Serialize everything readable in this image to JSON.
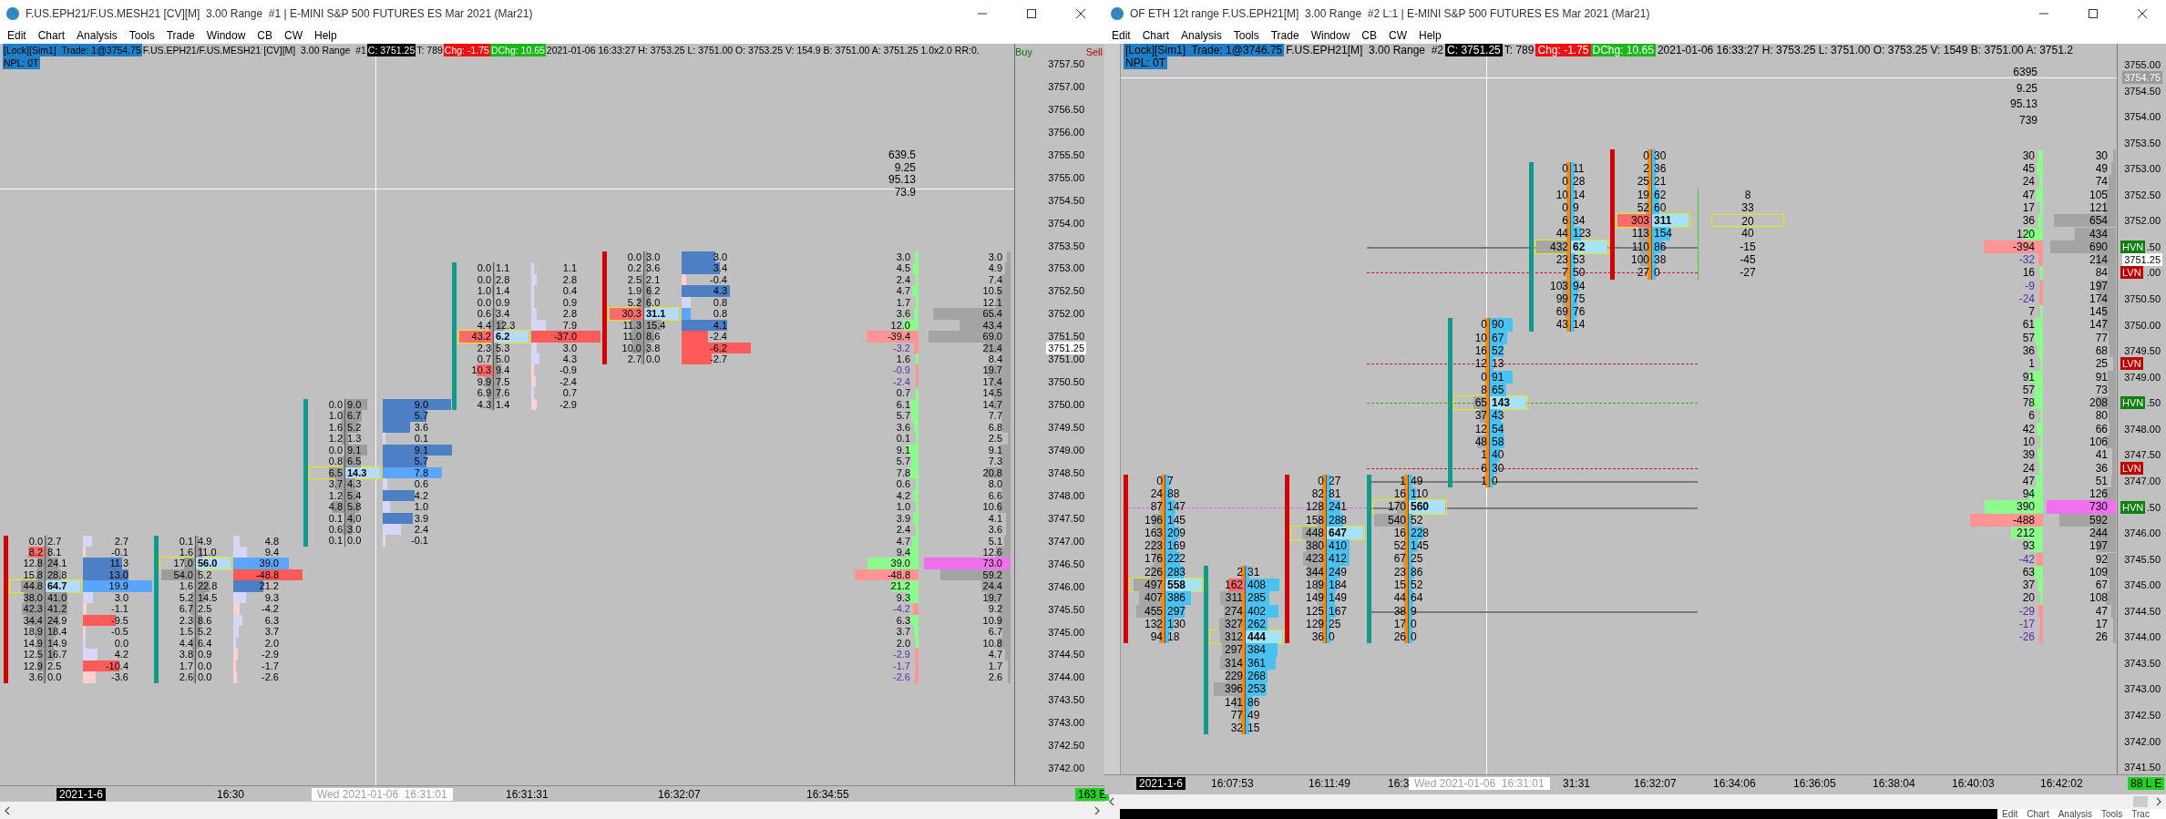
{
  "windows": [
    {
      "title": "F.US.EPH21/F.US.MESH21 [CV][M]  3.00 Range  #1 | E-MINI S&P 500 FUTURES ES Mar 2021 (Mar21)",
      "menu": [
        "Edit",
        "Chart",
        "Analysis",
        "Tools",
        "Trade",
        "Window",
        "CB",
        "CW",
        "Help"
      ],
      "info": {
        "account": "[Lock][Sim1]  Trade: 1@3754.75",
        "instrument": "F.US.EPH21/F.US.MESH21 [CV][M]  3.00 Range  #1",
        "close": "C: 3751.25",
        "ticks": "T: 789",
        "change": "Chg: -1.75",
        "day_change": "DChg: 10.65",
        "details": "2021-01-06 16:33:27 H: 3753.25 L: 3751.00 O: 3753.25 V: 154.9 B: 3751.00 A: 3751.25 1.0x2.0 RR:0.",
        "npl": "NPL: 0T"
      },
      "order_buttons": [
        {
          "label": "Buy",
          "kind": "buy"
        },
        {
          "label": "Sell",
          "kind": "sell"
        }
      ],
      "stats": [
        "639.5",
        "9.25",
        "95.13",
        "73.9"
      ],
      "columns": [
        {
          "kind": "down",
          "rows": [
            {
              "bid": "0.0",
              "ask": "2.7",
              "delta": "2.7",
              "poc": false,
              "alert": false
            },
            {
              "bid": "8.2",
              "ask": "8.1",
              "delta": "-0.1",
              "poc": false,
              "alert": true
            },
            {
              "bid": "12.8",
              "ask": "24.1",
              "delta": "11.3",
              "poc": false,
              "alert": false
            },
            {
              "bid": "15.8",
              "ask": "28.8",
              "delta": "13.0",
              "poc": false,
              "alert": false
            },
            {
              "bid": "44.8",
              "ask": "64.7",
              "delta": "19.9",
              "poc": true,
              "alert": false
            },
            {
              "bid": "38.0",
              "ask": "41.0",
              "delta": "3.0",
              "poc": false,
              "alert": false
            },
            {
              "bid": "42.3",
              "ask": "41.2",
              "delta": "-1.1",
              "poc": false,
              "alert": false
            },
            {
              "bid": "34.4",
              "ask": "24.9",
              "delta": "-9.5",
              "poc": false,
              "alert": false
            },
            {
              "bid": "18.9",
              "ask": "18.4",
              "delta": "-0.5",
              "poc": false,
              "alert": false
            },
            {
              "bid": "14.9",
              "ask": "14.9",
              "delta": "0.0",
              "poc": false,
              "alert": false
            },
            {
              "bid": "12.5",
              "ask": "16.7",
              "delta": "4.2",
              "poc": false,
              "alert": false
            },
            {
              "bid": "12.9",
              "ask": "2.5",
              "delta": "-10.4",
              "poc": false,
              "alert": false
            },
            {
              "bid": "3.6",
              "ask": "0.0",
              "delta": "-3.6",
              "poc": false,
              "alert": false
            }
          ]
        },
        {
          "kind": "up",
          "rows": [
            {
              "bid": "0.1",
              "ask": "4.9",
              "delta": "4.8",
              "poc": false,
              "alert": false
            },
            {
              "bid": "1.6",
              "ask": "11.0",
              "delta": "9.4",
              "poc": false,
              "alert": false
            },
            {
              "bid": "17.0",
              "ask": "56.0",
              "delta": "39.0",
              "poc": true,
              "alert": false
            },
            {
              "bid": "54.0",
              "ask": "5.2",
              "delta": "-48.8",
              "poc": false,
              "alert": false
            },
            {
              "bid": "1.6",
              "ask": "22.8",
              "delta": "21.2",
              "poc": false,
              "alert": false
            },
            {
              "bid": "5.2",
              "ask": "14.5",
              "delta": "9.3",
              "poc": false,
              "alert": false
            },
            {
              "bid": "6.7",
              "ask": "2.5",
              "delta": "-4.2",
              "poc": false,
              "alert": false
            },
            {
              "bid": "2.3",
              "ask": "8.6",
              "delta": "6.3",
              "poc": false,
              "alert": false
            },
            {
              "bid": "1.5",
              "ask": "5.2",
              "delta": "3.7",
              "poc": false,
              "alert": false
            },
            {
              "bid": "4.4",
              "ask": "6.4",
              "delta": "2.0",
              "poc": false,
              "alert": false
            },
            {
              "bid": "3.8",
              "ask": "0.9",
              "delta": "-2.9",
              "poc": false,
              "alert": false
            },
            {
              "bid": "1.7",
              "ask": "0.0",
              "delta": "-1.7",
              "poc": false,
              "alert": false
            },
            {
              "bid": "2.6",
              "ask": "0.0",
              "delta": "-2.6",
              "poc": false,
              "alert": false
            }
          ]
        },
        {
          "kind": "up",
          "rows": [
            {
              "bid": "0.0",
              "ask": "9.0",
              "delta": "9.0",
              "poc": false,
              "alert": false
            },
            {
              "bid": "1.0",
              "ask": "6.7",
              "delta": "5.7",
              "poc": false,
              "alert": false
            },
            {
              "bid": "1.6",
              "ask": "5.2",
              "delta": "3.6",
              "poc": false,
              "alert": false
            },
            {
              "bid": "1.2",
              "ask": "1.3",
              "delta": "0.1",
              "poc": false,
              "alert": false
            },
            {
              "bid": "0.0",
              "ask": "9.1",
              "delta": "9.1",
              "poc": false,
              "alert": false
            },
            {
              "bid": "0.8",
              "ask": "6.5",
              "delta": "5.7",
              "poc": false,
              "alert": false
            },
            {
              "bid": "6.5",
              "ask": "14.3",
              "delta": "7.8",
              "poc": true,
              "alert": false
            },
            {
              "bid": "3.7",
              "ask": "4.3",
              "delta": "0.6",
              "poc": false,
              "alert": false
            },
            {
              "bid": "1.2",
              "ask": "5.4",
              "delta": "4.2",
              "poc": false,
              "alert": false
            },
            {
              "bid": "4.8",
              "ask": "5.8",
              "delta": "1.0",
              "poc": false,
              "alert": false
            },
            {
              "bid": "0.1",
              "ask": "4.0",
              "delta": "3.9",
              "poc": false,
              "alert": false
            },
            {
              "bid": "0.6",
              "ask": "3.0",
              "delta": "2.4",
              "poc": false,
              "alert": false
            },
            {
              "bid": "0.1",
              "ask": "0.0",
              "delta": "-0.1",
              "poc": false,
              "alert": false
            }
          ]
        },
        {
          "kind": "up",
          "rows": [
            {
              "bid": "0.0",
              "ask": "1.1",
              "delta": "1.1",
              "poc": false,
              "alert": false
            },
            {
              "bid": "0.0",
              "ask": "2.8",
              "delta": "2.8",
              "poc": false,
              "alert": false
            },
            {
              "bid": "1.0",
              "ask": "1.4",
              "delta": "0.4",
              "poc": false,
              "alert": false
            },
            {
              "bid": "0.0",
              "ask": "0.9",
              "delta": "0.9",
              "poc": false,
              "alert": false
            },
            {
              "bid": "0.6",
              "ask": "3.4",
              "delta": "2.8",
              "poc": false,
              "alert": false
            },
            {
              "bid": "4.4",
              "ask": "12.3",
              "delta": "7.9",
              "poc": false,
              "alert": false
            },
            {
              "bid": "43.2",
              "ask": "6.2",
              "delta": "-37.0",
              "poc": true,
              "alert": true
            },
            {
              "bid": "2.3",
              "ask": "5.3",
              "delta": "3.0",
              "poc": false,
              "alert": false
            },
            {
              "bid": "0.7",
              "ask": "5.0",
              "delta": "4.3",
              "poc": false,
              "alert": false
            },
            {
              "bid": "10.3",
              "ask": "9.4",
              "delta": "-0.9",
              "poc": false,
              "alert": true
            },
            {
              "bid": "9.9",
              "ask": "7.5",
              "delta": "-2.4",
              "poc": false,
              "alert": false
            },
            {
              "bid": "6.9",
              "ask": "7.6",
              "delta": "0.7",
              "poc": false,
              "alert": false
            },
            {
              "bid": "4.3",
              "ask": "1.4",
              "delta": "-2.9",
              "poc": false,
              "alert": false
            }
          ]
        },
        {
          "kind": "down",
          "rows": [
            {
              "bid": "0.0",
              "ask": "3.0",
              "delta": "3.0",
              "poc": false,
              "alert": false
            },
            {
              "bid": "0.2",
              "ask": "3.6",
              "delta": "3.4",
              "poc": false,
              "alert": false
            },
            {
              "bid": "2.5",
              "ask": "2.1",
              "delta": "-0.4",
              "poc": false,
              "alert": false
            },
            {
              "bid": "1.9",
              "ask": "6.2",
              "delta": "4.3",
              "poc": false,
              "alert": false
            },
            {
              "bid": "5.2",
              "ask": "6.0",
              "delta": "0.8",
              "poc": false,
              "alert": false
            },
            {
              "bid": "30.3",
              "ask": "31.1",
              "delta": "0.8",
              "poc": true,
              "alert": true
            },
            {
              "bid": "11.3",
              "ask": "15.4",
              "delta": "4.1",
              "poc": false,
              "alert": false
            },
            {
              "bid": "11.0",
              "ask": "8.6",
              "delta": "-2.4",
              "poc": false,
              "alert": false
            },
            {
              "bid": "10.0",
              "ask": "3.8",
              "delta": "-6.2",
              "poc": false,
              "alert": false
            },
            {
              "bid": "2.7",
              "ask": "0.0",
              "delta": "-2.7",
              "poc": false,
              "alert": false
            }
          ]
        }
      ],
      "profile": {
        "delta": [
          "3.0",
          "4.5",
          "2.4",
          "4.7",
          "1.7",
          "3.6",
          "12.0",
          "-39.4",
          "-3.2",
          "1.6",
          "-0.9",
          "-2.4",
          "0.7",
          "6.1",
          "5.7",
          "3.6",
          "0.1",
          "9.1",
          "5.7",
          "7.8",
          "0.6",
          "4.2",
          "1.0",
          "3.9",
          "2.4",
          "4.7",
          "9.4",
          "39.0",
          "-48.8",
          "21.2",
          "9.3",
          "-4.2",
          "6.3",
          "3.7",
          "2.0",
          "-2.9",
          "-1.7",
          "-2.6"
        ],
        "volume": [
          "3.0",
          "4.9",
          "7.4",
          "10.5",
          "12.1",
          "65.4",
          "43.4",
          "69.0",
          "21.4",
          "8.4",
          "19.7",
          "17.4",
          "14.5",
          "14.7",
          "7.7",
          "6.8",
          "2.5",
          "9.1",
          "7.3",
          "20.8",
          "8.0",
          "6.6",
          "10.6",
          "4.1",
          "3.6",
          "5.1",
          "12.6",
          "73.0",
          "59.2",
          "24.4",
          "19.7",
          "9.2",
          "10.9",
          "6.7",
          "10.8",
          "4.7",
          "1.7",
          "2.6"
        ]
      },
      "price_axis": {
        "labels": [
          "3757.50",
          "3757.00",
          "3756.50",
          "3756.00",
          "3755.50",
          "3755.00",
          "3754.50",
          "3754.00",
          "3753.50",
          "3753.00",
          "3752.50",
          "3752.00",
          "3751.50",
          "3751.00",
          "3750.50",
          "3750.00",
          "3749.50",
          "3749.00",
          "3748.50",
          "3748.00",
          "3747.50",
          "3747.00",
          "3746.50",
          "3746.00",
          "3745.50",
          "3745.00",
          "3744.50",
          "3744.00",
          "3743.50",
          "3743.00",
          "3742.50",
          "3742.00"
        ],
        "current": "3751.25"
      },
      "time_axis": [
        {
          "text": "2021-1-6",
          "kind": "date"
        },
        {
          "text": "16:30",
          "kind": "plain"
        },
        {
          "text": "Wed 2021-01-06  16:31:01",
          "kind": "cursor"
        },
        {
          "text": "16:31:31",
          "kind": "plain"
        },
        {
          "text": "16:32:07",
          "kind": "plain"
        },
        {
          "text": "16:34:55",
          "kind": "plain"
        },
        {
          "text": "163 E",
          "kind": "status"
        }
      ]
    },
    {
      "title": "OF ETH 12t range F.US.EPH21[M]  3.00 Range  #2 L:1 | E-MINI S&P 500 FUTURES ES Mar 2021 (Mar21)",
      "menu": [
        "Edit",
        "Chart",
        "Analysis",
        "Tools",
        "Trade",
        "Window",
        "CB",
        "CW",
        "Help"
      ],
      "info": {
        "account": "[Lock][Sim1]  Trade: 1@3746.75",
        "instrument": "F.US.EPH21[M]  3.00 Range  #2",
        "close": "C: 3751.25",
        "ticks": "T: 789",
        "change": "Chg: -1.75",
        "day_change": "DChg: 10.65",
        "details": "2021-01-06 16:33:27 H: 3753.25 L: 3751.00 O: 3753.25 V: 1549 B: 3751.00 A: 3751.2",
        "npl": "NPL: 0T"
      },
      "stats": [
        "6395",
        "9.25",
        "95.13",
        "739"
      ],
      "columns": [
        {
          "kind": "down",
          "rows": [
            {
              "bid": "0",
              "ask": "7",
              "poc": false,
              "alert": false
            },
            {
              "bid": "24",
              "ask": "88",
              "poc": false,
              "alert": false
            },
            {
              "bid": "87",
              "ask": "147",
              "poc": false,
              "alert": false
            },
            {
              "bid": "196",
              "ask": "145",
              "poc": false,
              "alert": false
            },
            {
              "bid": "163",
              "ask": "209",
              "poc": false,
              "alert": false
            },
            {
              "bid": "223",
              "ask": "169",
              "poc": false,
              "alert": false
            },
            {
              "bid": "176",
              "ask": "222",
              "poc": false,
              "alert": false
            },
            {
              "bid": "226",
              "ask": "283",
              "poc": false,
              "alert": false
            },
            {
              "bid": "497",
              "ask": "558",
              "poc": true,
              "alert": false
            },
            {
              "bid": "407",
              "ask": "386",
              "poc": false,
              "alert": false
            },
            {
              "bid": "455",
              "ask": "297",
              "poc": false,
              "alert": false
            },
            {
              "bid": "132",
              "ask": "130",
              "poc": false,
              "alert": false
            },
            {
              "bid": "94",
              "ask": "18",
              "poc": false,
              "alert": false
            }
          ]
        },
        {
          "kind": "up",
          "rows": [
            {
              "bid": "2",
              "ask": "31",
              "poc": false,
              "alert": false
            },
            {
              "bid": "162",
              "ask": "408",
              "poc": false,
              "alert": true
            },
            {
              "bid": "311",
              "ask": "285",
              "poc": false,
              "alert": false
            },
            {
              "bid": "274",
              "ask": "402",
              "poc": false,
              "alert": false
            },
            {
              "bid": "327",
              "ask": "262",
              "poc": false,
              "alert": false
            },
            {
              "bid": "312",
              "ask": "444",
              "poc": true,
              "alert": false
            },
            {
              "bid": "297",
              "ask": "384",
              "poc": false,
              "alert": false
            },
            {
              "bid": "314",
              "ask": "361",
              "poc": false,
              "alert": false
            },
            {
              "bid": "229",
              "ask": "268",
              "poc": false,
              "alert": false
            },
            {
              "bid": "396",
              "ask": "253",
              "poc": false,
              "alert": false
            },
            {
              "bid": "141",
              "ask": "86",
              "poc": false,
              "alert": false
            },
            {
              "bid": "77",
              "ask": "49",
              "poc": false,
              "alert": false
            },
            {
              "bid": "32",
              "ask": "15",
              "poc": false,
              "alert": false
            }
          ]
        },
        {
          "kind": "down",
          "rows": [
            {
              "bid": "0",
              "ask": "27",
              "poc": false,
              "alert": false
            },
            {
              "bid": "82",
              "ask": "81",
              "poc": false,
              "alert": false
            },
            {
              "bid": "128",
              "ask": "241",
              "poc": false,
              "alert": false
            },
            {
              "bid": "158",
              "ask": "288",
              "poc": false,
              "alert": false
            },
            {
              "bid": "448",
              "ask": "647",
              "poc": true,
              "alert": false
            },
            {
              "bid": "380",
              "ask": "410",
              "poc": false,
              "alert": false
            },
            {
              "bid": "423",
              "ask": "412",
              "poc": false,
              "alert": false
            },
            {
              "bid": "344",
              "ask": "249",
              "poc": false,
              "alert": false
            },
            {
              "bid": "189",
              "ask": "184",
              "poc": false,
              "alert": false
            },
            {
              "bid": "149",
              "ask": "149",
              "poc": false,
              "alert": false
            },
            {
              "bid": "125",
              "ask": "167",
              "poc": false,
              "alert": false
            },
            {
              "bid": "129",
              "ask": "25",
              "poc": false,
              "alert": false
            },
            {
              "bid": "36",
              "ask": "0",
              "poc": false,
              "alert": false
            }
          ]
        },
        {
          "kind": "up",
          "rows": [
            {
              "bid": "1",
              "ask": "49",
              "poc": false,
              "alert": false
            },
            {
              "bid": "16",
              "ask": "110",
              "poc": false,
              "alert": false
            },
            {
              "bid": "170",
              "ask": "560",
              "poc": true,
              "alert": false
            },
            {
              "bid": "540",
              "ask": "52",
              "poc": false,
              "alert": false
            },
            {
              "bid": "16",
              "ask": "228",
              "poc": false,
              "alert": false
            },
            {
              "bid": "52",
              "ask": "145",
              "poc": false,
              "alert": false
            },
            {
              "bid": "67",
              "ask": "25",
              "poc": false,
              "alert": false
            },
            {
              "bid": "23",
              "ask": "86",
              "poc": false,
              "alert": false
            },
            {
              "bid": "15",
              "ask": "52",
              "poc": false,
              "alert": false
            },
            {
              "bid": "44",
              "ask": "64",
              "poc": false,
              "alert": false
            },
            {
              "bid": "38",
              "ask": "9",
              "poc": false,
              "alert": false
            },
            {
              "bid": "17",
              "ask": "0",
              "poc": false,
              "alert": false
            },
            {
              "bid": "26",
              "ask": "0",
              "poc": false,
              "alert": false
            }
          ]
        },
        {
          "kind": "up",
          "rows": [
            {
              "bid": "0",
              "ask": "90",
              "poc": false,
              "alert": false
            },
            {
              "bid": "10",
              "ask": "67",
              "poc": false,
              "alert": false
            },
            {
              "bid": "16",
              "ask": "52",
              "poc": false,
              "alert": false
            },
            {
              "bid": "12",
              "ask": "13",
              "poc": false,
              "alert": false
            },
            {
              "bid": "0",
              "ask": "91",
              "poc": false,
              "alert": false
            },
            {
              "bid": "8",
              "ask": "65",
              "poc": false,
              "alert": false
            },
            {
              "bid": "65",
              "ask": "143",
              "poc": true,
              "alert": false
            },
            {
              "bid": "37",
              "ask": "43",
              "poc": false,
              "alert": false
            },
            {
              "bid": "12",
              "ask": "54",
              "poc": false,
              "alert": false
            },
            {
              "bid": "48",
              "ask": "58",
              "poc": false,
              "alert": false
            },
            {
              "bid": "1",
              "ask": "40",
              "poc": false,
              "alert": false
            },
            {
              "bid": "6",
              "ask": "30",
              "poc": false,
              "alert": false
            },
            {
              "bid": "1",
              "ask": "0",
              "poc": false,
              "alert": false
            }
          ]
        },
        {
          "kind": "up",
          "rows": [
            {
              "bid": "0",
              "ask": "11",
              "poc": false,
              "alert": false
            },
            {
              "bid": "0",
              "ask": "28",
              "poc": false,
              "alert": false
            },
            {
              "bid": "10",
              "ask": "14",
              "poc": false,
              "alert": false
            },
            {
              "bid": "0",
              "ask": "9",
              "poc": false,
              "alert": false
            },
            {
              "bid": "6",
              "ask": "34",
              "poc": false,
              "alert": false
            },
            {
              "bid": "44",
              "ask": "123",
              "poc": false,
              "alert": false
            },
            {
              "bid": "432",
              "ask": "62",
              "poc": true,
              "alert": false
            },
            {
              "bid": "23",
              "ask": "53",
              "poc": false,
              "alert": false
            },
            {
              "bid": "7",
              "ask": "50",
              "poc": false,
              "alert": false
            },
            {
              "bid": "103",
              "ask": "94",
              "poc": false,
              "alert": false
            },
            {
              "bid": "99",
              "ask": "75",
              "poc": false,
              "alert": false
            },
            {
              "bid": "69",
              "ask": "76",
              "poc": false,
              "alert": false
            },
            {
              "bid": "43",
              "ask": "14",
              "poc": false,
              "alert": false
            }
          ]
        },
        {
          "kind": "down",
          "rows": [
            {
              "bid": "0",
              "ask": "30",
              "poc": false,
              "alert": false
            },
            {
              "bid": "2",
              "ask": "36",
              "poc": false,
              "alert": false
            },
            {
              "bid": "25",
              "ask": "21",
              "poc": false,
              "alert": false
            },
            {
              "bid": "19",
              "ask": "62",
              "poc": false,
              "alert": false
            },
            {
              "bid": "52",
              "ask": "60",
              "poc": false,
              "alert": false
            },
            {
              "bid": "303",
              "ask": "311",
              "poc": true,
              "alert": true
            },
            {
              "bid": "113",
              "ask": "154",
              "poc": false,
              "alert": false
            },
            {
              "bid": "110",
              "ask": "86",
              "poc": false,
              "alert": false
            },
            {
              "bid": "100",
              "ask": "38",
              "poc": false,
              "alert": false
            },
            {
              "bid": "27",
              "ask": "0",
              "poc": false,
              "alert": false
            }
          ]
        },
        {
          "kind": "delta",
          "rows": [
            {
              "delta": "8",
              "poc": false
            },
            {
              "delta": "33",
              "poc": false
            },
            {
              "delta": "20",
              "poc": true
            },
            {
              "delta": "40",
              "poc": false
            },
            {
              "delta": "-15",
              "poc": false
            },
            {
              "delta": "-45",
              "poc": false
            },
            {
              "delta": "-27",
              "poc": false
            }
          ]
        }
      ],
      "profile": {
        "delta": [
          "30",
          "45",
          "24",
          "47",
          "17",
          "36",
          "120",
          "-394",
          "-32",
          "16",
          "-9",
          "-24",
          "7",
          "61",
          "57",
          "36",
          "1",
          "91",
          "57",
          "78",
          "6",
          "42",
          "10",
          "39",
          "24",
          "47",
          "94",
          "390",
          "-488",
          "212",
          "93",
          "-42",
          "63",
          "37",
          "20",
          "-29",
          "-17",
          "-26"
        ],
        "volume": [
          "30",
          "49",
          "74",
          "105",
          "121",
          "654",
          "434",
          "690",
          "214",
          "84",
          "197",
          "174",
          "145",
          "147",
          "77",
          "68",
          "25",
          "91",
          "73",
          "208",
          "80",
          "66",
          "106",
          "41",
          "36",
          "51",
          "126",
          "730",
          "592",
          "244",
          "197",
          "92",
          "109",
          "67",
          "108",
          "47",
          "17",
          "26"
        ]
      },
      "levels": [
        {
          "kind": "poc"
        },
        {
          "kind": "lvn"
        },
        {
          "kind": "lvn"
        },
        {
          "kind": "hvn"
        },
        {
          "kind": "lvn"
        },
        {
          "kind": "poc"
        },
        {
          "kind": "vwap"
        },
        {
          "kind": "poc"
        },
        {
          "kind": "poc"
        }
      ],
      "tags": [
        {
          "label": "HVN",
          "kind": "hvn"
        },
        {
          "label": "LVN",
          "kind": "lvn"
        },
        {
          "label": "LVN",
          "kind": "lvn"
        },
        {
          "label": "HVN",
          "kind": "hvn"
        },
        {
          "label": "LVN",
          "kind": "lvn"
        },
        {
          "label": "HVN",
          "kind": "hvn"
        }
      ],
      "price_axis": {
        "labels": [
          "3755.00",
          "3754.50",
          "3754.00",
          "3753.50",
          "3753.00",
          "3752.50",
          "3752.00",
          ".50",
          ".00",
          "3750.50",
          "3750.00",
          "3749.50",
          "3749.00",
          ".50",
          "3748.00",
          "3747.50",
          "3747.00",
          ".50",
          "3746.00",
          "3745.50",
          "3745.00",
          "3744.50",
          "3744.00",
          "3743.50",
          "3743.00",
          "3742.50",
          "3742.00",
          "3741.50"
        ],
        "current": "3751.25",
        "crosshair": "3754.75"
      },
      "time_axis": [
        {
          "text": "2021-1-6",
          "kind": "date"
        },
        {
          "text": "16:07:53",
          "kind": "plain"
        },
        {
          "text": "16:11:49",
          "kind": "plain"
        },
        {
          "text": "16:3",
          "kind": "plain"
        },
        {
          "text": "Wed 2021-01-06  16:31:01",
          "kind": "cursor"
        },
        {
          "text": "31:31",
          "kind": "plain"
        },
        {
          "text": "16:32:07",
          "kind": "plain"
        },
        {
          "text": "16:34:06",
          "kind": "plain"
        },
        {
          "text": "16:36:05",
          "kind": "plain"
        },
        {
          "text": "16:38:04",
          "kind": "plain"
        },
        {
          "text": "16:40:03",
          "kind": "plain"
        },
        {
          "text": "16:42:02",
          "kind": "plain"
        },
        {
          "text": "88 L E",
          "kind": "status"
        }
      ]
    }
  ],
  "background_window": {
    "menu": [
      "Edit",
      "Chart",
      "Analysis",
      "Tools",
      "Trac"
    ]
  }
}
